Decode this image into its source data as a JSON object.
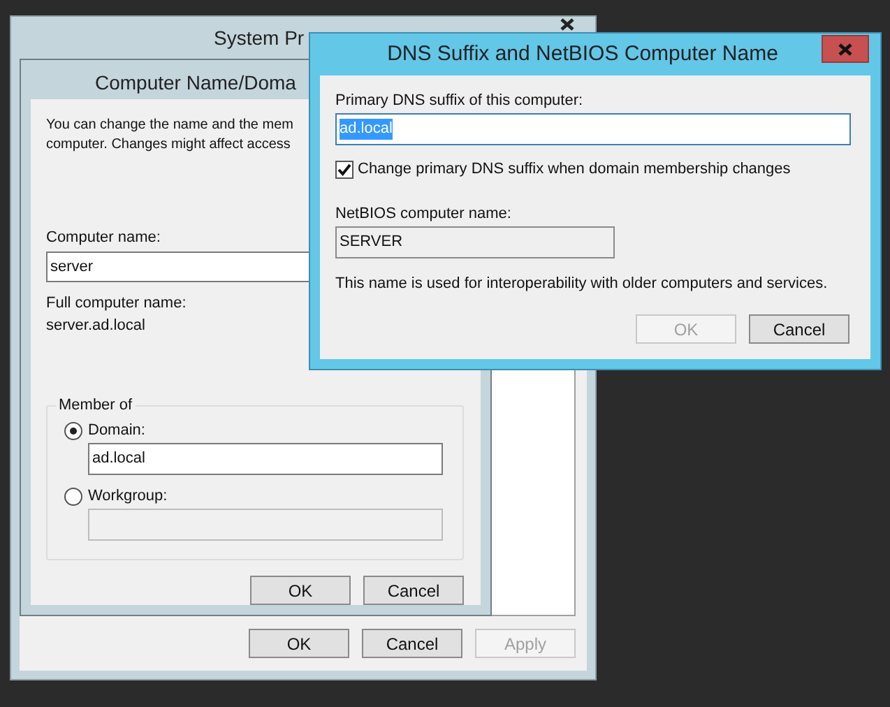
{
  "system_properties": {
    "title": "System Pr",
    "buttons": [
      {
        "label": "OK",
        "disabled": false
      },
      {
        "label": "Cancel",
        "disabled": false
      },
      {
        "label": "Apply",
        "disabled": true
      }
    ]
  },
  "computer_name_dialog": {
    "title": "Computer Name/Doma",
    "intro_lines": [
      "You can change the name and the mem",
      "computer. Changes might affect access"
    ],
    "computer_name": {
      "label": "Computer name:",
      "value": "server"
    },
    "full_name": {
      "label": "Full computer name:",
      "value": "server.ad.local"
    },
    "member_of": {
      "title": "Member of",
      "options": [
        {
          "label": "Domain:",
          "selected": true,
          "value": "ad.local"
        },
        {
          "label": "Workgroup:",
          "selected": false
        }
      ]
    },
    "buttons": [
      {
        "label": "OK",
        "disabled": false
      },
      {
        "label": "Cancel",
        "disabled": false
      }
    ]
  },
  "dns_dialog": {
    "title": "DNS Suffix and NetBIOS Computer Name",
    "suffix": {
      "label": "Primary DNS suffix of this computer:",
      "value": "ad.local",
      "text_selected": true
    },
    "change_suffix": {
      "label": "Change primary DNS suffix when domain membership changes",
      "checked": true
    },
    "netbios": {
      "label": "NetBIOS computer name:",
      "value": "SERVER",
      "read_only": true
    },
    "info": "This name is used for interoperability with older computers and services.",
    "buttons": [
      {
        "label": "OK",
        "disabled": true
      },
      {
        "label": "Cancel",
        "disabled": false
      }
    ]
  }
}
